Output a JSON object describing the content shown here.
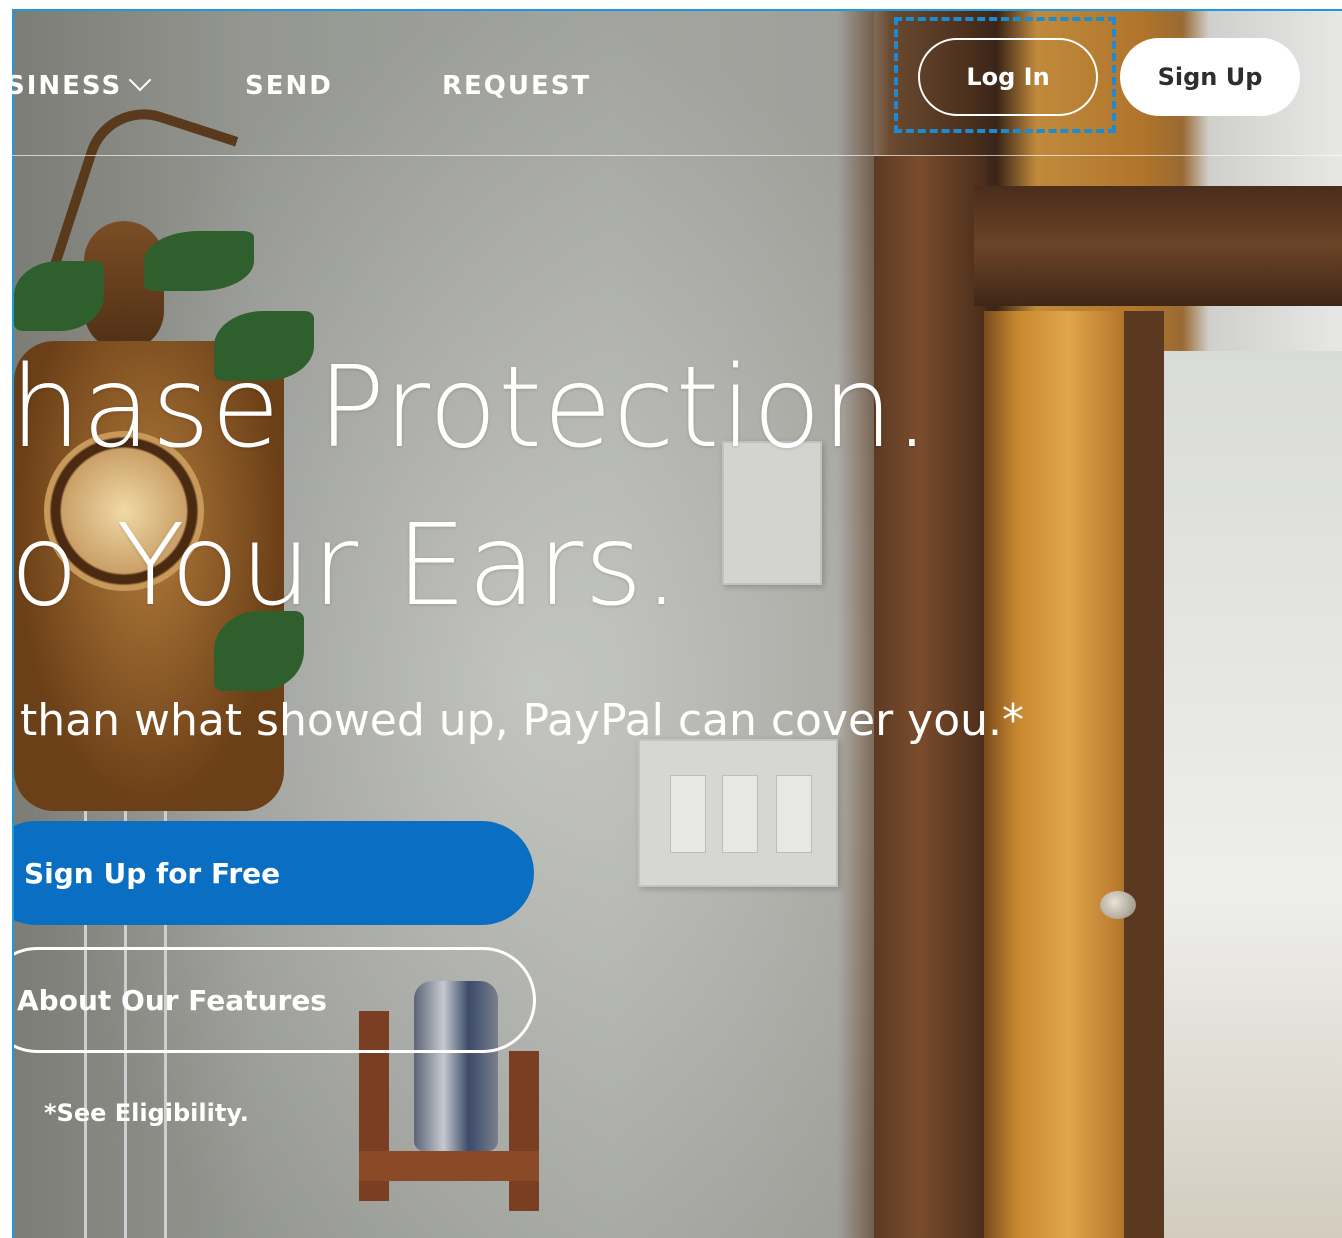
{
  "nav": {
    "business_label": "SINESS",
    "send_label": "SEND",
    "request_label": "REQUEST",
    "login_label": "Log In",
    "signup_label": "Sign Up"
  },
  "hero": {
    "headline_line1": "hase Protection.",
    "headline_line2": "o Your Ears.",
    "subheadline": "than what showed up, PayPal can cover you.*",
    "primary_cta": "Sign Up for Free",
    "secondary_cta": "About Our Features",
    "eligibility_link": "*See Eligibility."
  },
  "colors": {
    "accent_blue": "#0a6fc2",
    "highlight_border": "#1d8bd1",
    "text_white": "#ffffff"
  },
  "icons": {
    "business_dropdown": "chevron-down-icon"
  }
}
